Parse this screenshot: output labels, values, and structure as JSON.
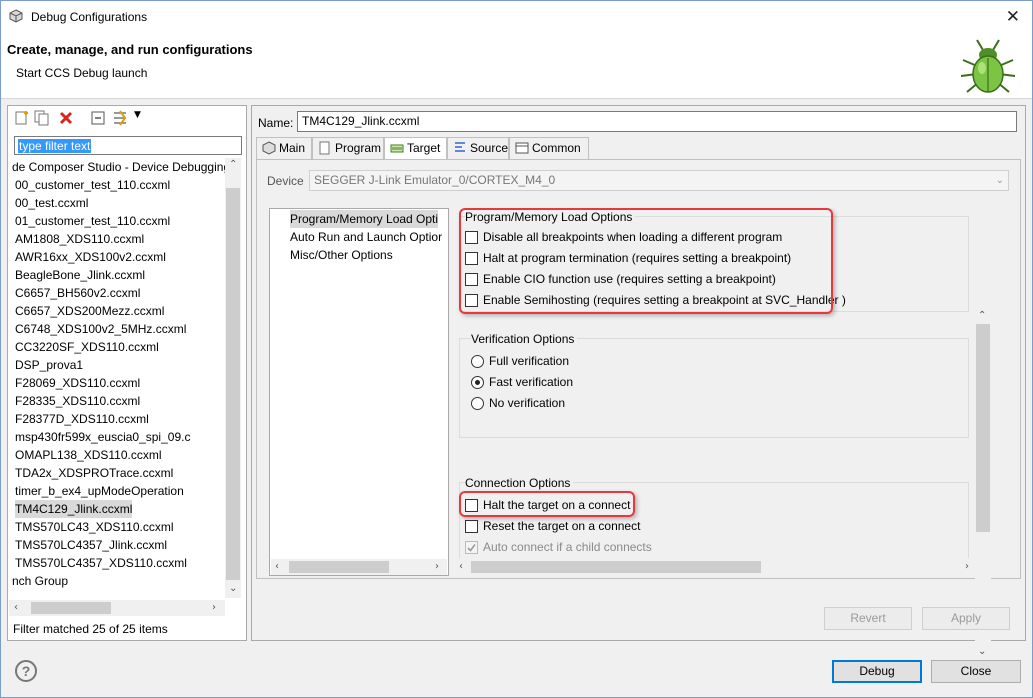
{
  "window": {
    "title": "Debug Configurations",
    "close_glyph": "✕"
  },
  "header": {
    "title": "Create, manage, and run configurations",
    "subtitle": "Start CCS Debug launch"
  },
  "left": {
    "filter_placeholder": "type filter text",
    "items": [
      "de Composer Studio - Device Debugging",
      "00_customer_test_110.ccxml",
      "00_test.ccxml",
      "01_customer_test_110.ccxml",
      "AM1808_XDS110.ccxml",
      "AWR16xx_XDS100v2.ccxml",
      "BeagleBone_Jlink.ccxml",
      "C6657_BH560v2.ccxml",
      "C6657_XDS200Mezz.ccxml",
      "C6748_XDS100v2_5MHz.ccxml",
      "CC3220SF_XDS110.ccxml",
      "DSP_prova1",
      "F28069_XDS110.ccxml",
      "F28335_XDS110.ccxml",
      "F28377D_XDS110.ccxml",
      "msp430fr599x_euscia0_spi_09.c",
      "OMAPL138_XDS110.ccxml",
      "TDA2x_XDSPROTrace.ccxml",
      "timer_b_ex4_upModeOperation",
      "TM4C129_Jlink.ccxml",
      "TMS570LC43_XDS110.ccxml",
      "TMS570LC4357_Jlink.ccxml",
      "TMS570LC4357_XDS110.ccxml",
      "nch Group"
    ],
    "selected_index": 19,
    "status": "Filter matched 25 of 25 items"
  },
  "right": {
    "name_label": "Name:",
    "name_value": "TM4C129_Jlink.ccxml",
    "tabs": [
      "Main",
      "Program",
      "Target",
      "Source",
      "Common"
    ],
    "active_tab": "Target",
    "device_label": "Device",
    "device_value": "SEGGER J-Link Emulator_0/CORTEX_M4_0",
    "tree": [
      "Program/Memory Load Opti",
      "Auto Run and Launch Optior",
      "Misc/Other Options"
    ],
    "program_group": {
      "title": "Program/Memory Load Options",
      "items": [
        "Disable all breakpoints when loading a different program",
        "Halt at program termination (requires setting a breakpoint)",
        "Enable CIO function use (requires setting a breakpoint)",
        "Enable Semihosting (requires setting a breakpoint at SVC_Handler )"
      ]
    },
    "verification_group": {
      "title": "Verification Options",
      "options": [
        "Full verification",
        "Fast verification",
        "No verification"
      ],
      "selected": "Fast verification"
    },
    "connection_group": {
      "title": "Connection Options",
      "items": [
        "Halt the target on a connect",
        "Reset the target on a connect",
        "Auto connect if a child connects"
      ],
      "auto_connect_checked": true
    },
    "buttons": {
      "revert": "Revert",
      "apply": "Apply"
    }
  },
  "footer": {
    "debug": "Debug",
    "close": "Close",
    "help": "?"
  },
  "colors": {
    "highlight": "#e8383d",
    "selection": "#3399ff",
    "bug_green": "#6ab43a"
  }
}
